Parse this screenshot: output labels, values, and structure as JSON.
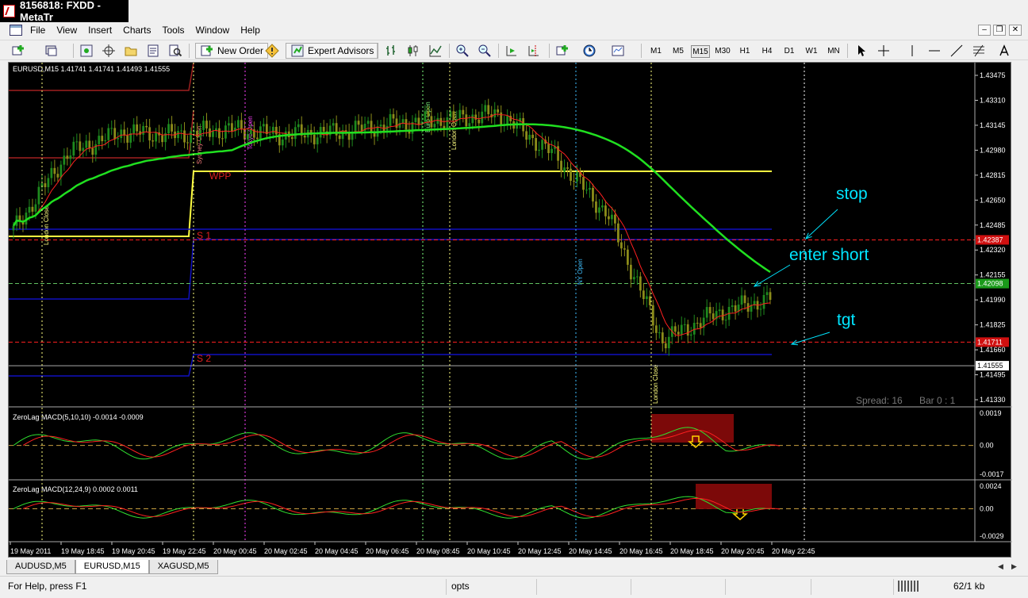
{
  "window": {
    "title": "8156818: FXDD - MetaTr"
  },
  "menu": [
    "File",
    "View",
    "Insert",
    "Charts",
    "Tools",
    "Window",
    "Help"
  ],
  "toolbar": {
    "new_order": "New Order",
    "expert_advisors": "Expert Advisors",
    "timeframes": [
      "M1",
      "M5",
      "M15",
      "M30",
      "H1",
      "H4",
      "D1",
      "W1",
      "MN"
    ],
    "active_timeframe": "M15"
  },
  "chart": {
    "header": "EURUSD,M15  1.41741 1.41741 1.41493 1.41555",
    "price_ticks": [
      "1.43475",
      "1.43310",
      "1.43145",
      "1.42980",
      "1.42815",
      "1.42650",
      "1.42485",
      "1.42320",
      "1.42155",
      "1.41990",
      "1.41825",
      "1.41660",
      "1.41495",
      "1.41330"
    ],
    "price_tags": {
      "stop": "1.42387",
      "entry": "1.42098",
      "target": "1.41711",
      "current": "1.41555"
    },
    "pivot_labels": {
      "wpp": "WPP",
      "s1": "S 1",
      "s2": "S 2"
    },
    "session_labels": [
      "London Close",
      "Sydney Open",
      "Tokyo Open",
      "Euro Open",
      "London Open",
      "NY Open",
      "London Close"
    ],
    "annotations": {
      "stop": "stop",
      "enter": "enter short",
      "target": "tgt"
    },
    "spread_text": "Spread: 16",
    "bar_text": "Bar  0 : 1",
    "time_labels": [
      "19 May 2011",
      "19 May 18:45",
      "19 May 20:45",
      "19 May 22:45",
      "20 May 00:45",
      "20 May 02:45",
      "20 May 04:45",
      "20 May 06:45",
      "20 May 08:45",
      "20 May 10:45",
      "20 May 12:45",
      "20 May 14:45",
      "20 May 16:45",
      "20 May 18:45",
      "20 May 20:45",
      "20 May 22:45"
    ],
    "colors": {
      "bull_candle": "#1e8a1e",
      "bear_candle": "#8c8c1a",
      "ma_fast": "#ff2020",
      "ma_slow": "#20e020",
      "pivot": "#ffff40",
      "support": "#1010c0",
      "accent_cyan": "#00e5ff"
    }
  },
  "macd1": {
    "label": "ZeroLag MACD(5,10,10) -0.0014 -0.0009",
    "ticks": [
      "0.0019",
      "0.00",
      "-0.0017"
    ]
  },
  "macd2": {
    "label": "ZeroLag MACD(12,24,9) 0.0002 0.0011",
    "ticks": [
      "0.0024",
      "0.00",
      "-0.0029"
    ]
  },
  "tabs": [
    "AUDUSD,M5",
    "EURUSD,M15",
    "XAGUSD,M5"
  ],
  "active_tab": "EURUSD,M15",
  "status": {
    "help": "For Help, press F1",
    "profile": "opts",
    "traffic": "62/1 kb"
  },
  "chart_data": {
    "type": "line",
    "title": "EURUSD,M15",
    "ylim": [
      1.4133,
      1.4348
    ],
    "x": [
      "19 May 2011",
      "19 May 18:45",
      "19 May 20:45",
      "19 May 22:45",
      "20 May 00:45",
      "20 May 02:45",
      "20 May 04:45",
      "20 May 06:45",
      "20 May 08:45",
      "20 May 10:45",
      "20 May 12:45",
      "20 May 14:45",
      "20 May 16:45",
      "20 May 18:45",
      "20 May 20:45"
    ],
    "series": [
      {
        "values": [
          1.4245,
          1.4296,
          1.431,
          1.4308,
          1.4312,
          1.4308,
          1.431,
          1.4315,
          1.4318,
          1.4322,
          1.4295,
          1.4255,
          1.4172,
          1.419,
          1.42
        ]
      }
    ]
  }
}
